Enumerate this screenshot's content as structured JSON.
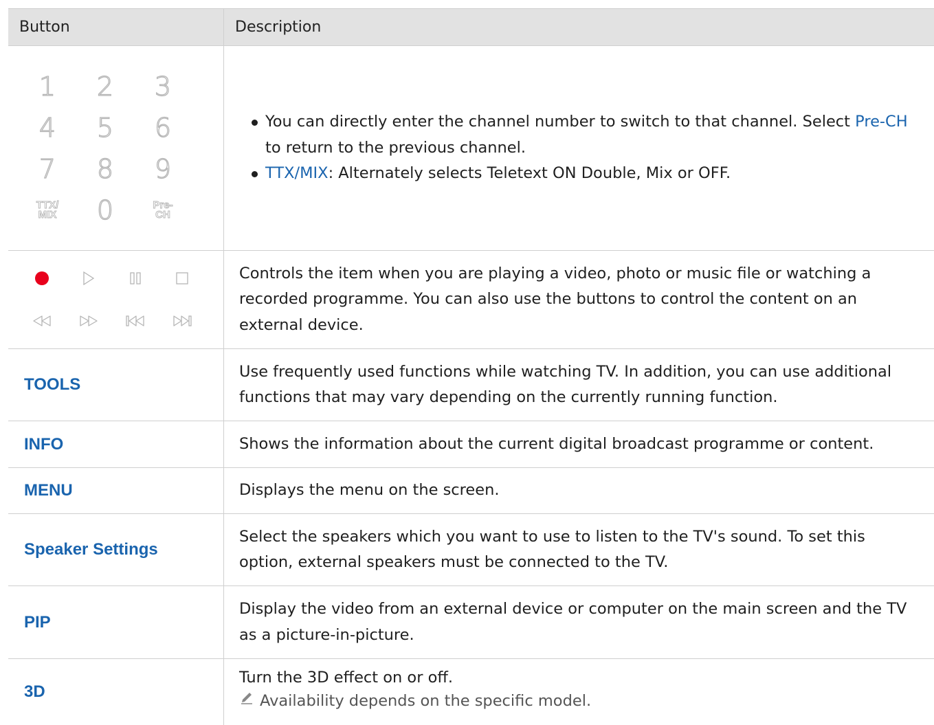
{
  "table": {
    "header": {
      "button": "Button",
      "description": "Description"
    },
    "keypad": {
      "keys": [
        "1",
        "2",
        "3",
        "4",
        "5",
        "6",
        "7",
        "8",
        "9"
      ],
      "ttx_top": "TTX/",
      "ttx_bottom": "MIX",
      "zero": "0",
      "prech_top": "Pre-",
      "prech_bottom": "CH"
    },
    "rows": [
      {
        "bullet1_a": "You can directly enter the channel number to switch to that channel. Select ",
        "bullet1_link": "Pre-CH",
        "bullet1_b": " to return to the previous channel.",
        "bullet2_link": "TTX/MIX",
        "bullet2_b": ": Alternately selects Teletext ON Double, Mix or OFF."
      },
      {
        "desc": "Controls the item when you are playing a video, photo or music file or watching a recorded programme. You can also use the buttons to control the content on an external device."
      },
      {
        "button": "TOOLS",
        "desc": "Use frequently used functions while watching TV. In addition, you can use additional functions that may vary depending on the currently running function."
      },
      {
        "button": "INFO",
        "desc": "Shows the information about the current digital broadcast programme or content."
      },
      {
        "button": "MENU",
        "desc": "Displays the menu on the screen."
      },
      {
        "button": "Speaker Settings",
        "desc": "Select the speakers which you want to use to listen to the TV's sound. To set this option, external speakers must be connected to the TV."
      },
      {
        "button": "PIP",
        "desc": "Display the video from an external device or computer on the main screen and the TV as a picture-in-picture."
      },
      {
        "button": "3D",
        "desc": "Turn the 3D effect on or off.",
        "note": "Availability depends on the specific model."
      }
    ]
  },
  "colors": {
    "link": "#1a64ae",
    "header_bg": "#e2e2e2",
    "record": "#e8001c",
    "border": "#cfcfcf"
  },
  "icons": {
    "media": [
      "record-icon",
      "play-icon",
      "pause-icon",
      "stop-icon",
      "rewind-icon",
      "fast-forward-icon",
      "previous-icon",
      "next-icon"
    ],
    "note": "pencil-note-icon"
  }
}
